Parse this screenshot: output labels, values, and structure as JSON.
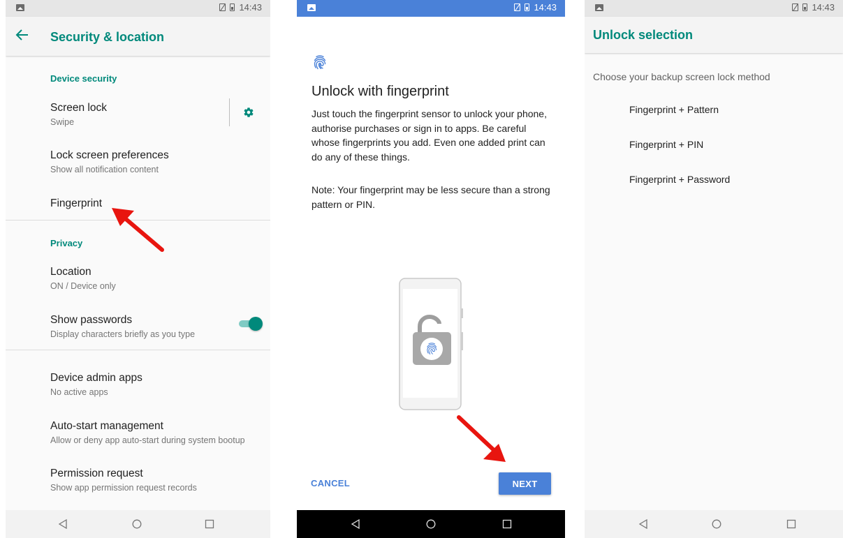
{
  "status": {
    "time": "14:43"
  },
  "screen1": {
    "title": "Security & location",
    "section_device": "Device security",
    "screen_lock": {
      "title": "Screen lock",
      "sub": "Swipe"
    },
    "lock_prefs": {
      "title": "Lock screen preferences",
      "sub": "Show all notification content"
    },
    "fingerprint": {
      "title": "Fingerprint"
    },
    "section_privacy": "Privacy",
    "location": {
      "title": "Location",
      "sub": "ON / Device only"
    },
    "show_passwords": {
      "title": "Show passwords",
      "sub": "Display characters briefly as you type",
      "enabled": true
    },
    "device_admin": {
      "title": "Device admin apps",
      "sub": "No active apps"
    },
    "autostart": {
      "title": "Auto-start management",
      "sub": "Allow or deny app auto-start during system bootup"
    },
    "permission": {
      "title": "Permission request",
      "sub": "Show app permission request records"
    }
  },
  "screen2": {
    "title": "Unlock with fingerprint",
    "body": "Just touch the fingerprint sensor to unlock your phone, authorise purchases or sign in to apps. Be careful whose fingerprints you add. Even one added print can do any of these things.",
    "note": "Note: Your fingerprint may be less secure than a strong pattern or PIN.",
    "cancel": "CANCEL",
    "next": "NEXT"
  },
  "screen3": {
    "title": "Unlock selection",
    "subtitle": "Choose your backup screen lock method",
    "options": [
      "Fingerprint + Pattern",
      "Fingerprint + PIN",
      "Fingerprint + Password"
    ]
  },
  "colors": {
    "accent": "#00897b",
    "blue": "#4a81d8",
    "arrow": "#e8150f"
  },
  "icons": [
    "back-arrow-icon",
    "gear-icon",
    "fingerprint-icon",
    "nav-back-icon",
    "nav-home-icon",
    "nav-recents-icon"
  ]
}
